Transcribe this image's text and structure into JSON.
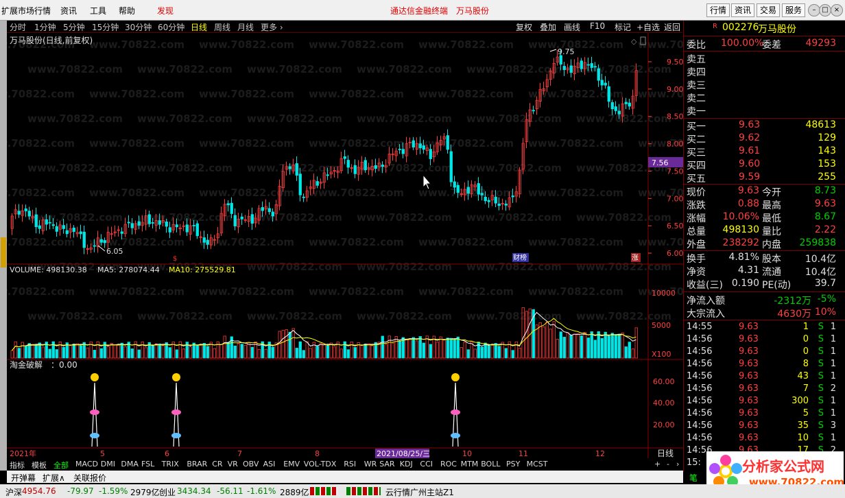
{
  "menu": {
    "items": [
      "扩展市场行情",
      "资讯",
      "工具",
      "帮助"
    ],
    "discover": "发现",
    "center_a": "通达信金融终端",
    "center_b": "万马股份",
    "right_tabs": [
      "行情",
      "资讯",
      "交易",
      "服务"
    ]
  },
  "periods": [
    "分时",
    "1分钟",
    "5分钟",
    "15分钟",
    "30分钟",
    "60分钟",
    "日线",
    "周线",
    "月线",
    "更多 ›"
  ],
  "active_period": "日线",
  "chart_tools": [
    "复权",
    "叠加",
    "画线",
    "F10",
    "标记",
    "+自选",
    "返回"
  ],
  "chart_title": "万马股份(日线,前复权)",
  "price_high_label": "9.75",
  "price_low_label": "6.05",
  "price_marker": "7.56",
  "price_axis": [
    "9.50",
    "9.00",
    "8.50",
    "8.00",
    "7.50",
    "7.00",
    "6.50",
    "6.00"
  ],
  "markers": {
    "finance": "财榜",
    "limit": "涨"
  },
  "volume_header": {
    "vol": "VOLUME: 498130.38",
    "ma5": "MA5: 278074.44",
    "ma10": "MA10: 275529.81"
  },
  "volume_axis": [
    "10000",
    "5000"
  ],
  "volume_unit": "X100",
  "indicator_header": "淘金破解　：0.00",
  "indicator_axis": [
    "60.00",
    "40.00",
    "20.00"
  ],
  "date_axis": [
    "2021年",
    "5",
    "6",
    "7",
    "8",
    "2021/08/25/三",
    "10",
    "11",
    "12"
  ],
  "timeframe_label": "日线",
  "indicator_tabs": [
    "指标",
    "模板",
    "全部",
    "MACD",
    "DMI",
    "DMA",
    "FSL",
    "TRIX",
    "BRAR",
    "CR",
    "VR",
    "OBV",
    "ASI",
    "EMV",
    "VOL-TDX",
    "RSI",
    "WR",
    "SAR",
    "KDJ",
    "CCI",
    "ROC",
    "MTM",
    "BOLL",
    "PSY",
    "MCST"
  ],
  "active_indicator_tab": "全部",
  "toolbar2": [
    "开弹幕",
    "扩展∧",
    "关联报价"
  ],
  "stock": {
    "flag": "R",
    "code": "002276",
    "name": "万马股份"
  },
  "webi": {
    "label": "委比",
    "value": "100.00%",
    "label2": "委差",
    "value2": "49293"
  },
  "sell": [
    {
      "l": "卖五",
      "p": "",
      "v": ""
    },
    {
      "l": "卖四",
      "p": "",
      "v": ""
    },
    {
      "l": "卖三",
      "p": "",
      "v": ""
    },
    {
      "l": "卖二",
      "p": "",
      "v": ""
    },
    {
      "l": "卖一",
      "p": "",
      "v": ""
    }
  ],
  "buy": [
    {
      "l": "买一",
      "p": "9.63",
      "v": "48613"
    },
    {
      "l": "买二",
      "p": "9.62",
      "v": "129"
    },
    {
      "l": "买三",
      "p": "9.61",
      "v": "143"
    },
    {
      "l": "买四",
      "p": "9.60",
      "v": "153"
    },
    {
      "l": "买五",
      "p": "9.59",
      "v": "255"
    }
  ],
  "quote": [
    {
      "a": "现价",
      "av": "9.63",
      "b": "今开",
      "bv": "8.73",
      "ac": "red",
      "bc": "grn"
    },
    {
      "a": "涨跌",
      "av": "0.88",
      "b": "最高",
      "bv": "9.63",
      "ac": "red",
      "bc": "red"
    },
    {
      "a": "涨幅",
      "av": "10.06%",
      "b": "最低",
      "bv": "8.67",
      "ac": "red",
      "bc": "grn"
    },
    {
      "a": "总量",
      "av": "498130",
      "b": "量比",
      "bv": "2.22",
      "ac": "yel",
      "bc": "red"
    },
    {
      "a": "外盘",
      "av": "238292",
      "b": "内盘",
      "bv": "259838",
      "ac": "red",
      "bc": "grn"
    }
  ],
  "fund": [
    {
      "a": "换手",
      "av": "4.81%",
      "b": "股本",
      "bv": "10.4亿"
    },
    {
      "a": "净资",
      "av": "4.31",
      "b": "流通",
      "bv": "10.4亿"
    },
    {
      "a": "收益(三)",
      "av": "0.190",
      "b": "PE(动)",
      "bv": "39.7"
    }
  ],
  "flow": [
    {
      "a": "净流入额",
      "av": "-2312万",
      "bv": "-5%",
      "c": "grn"
    },
    {
      "a": "大宗流入",
      "av": "4630万",
      "bv": "10%",
      "c": "red"
    }
  ],
  "ticks": [
    {
      "t": "14:55",
      "p": "9.63",
      "v": "1",
      "s": "S",
      "n": "1"
    },
    {
      "t": "14:56",
      "p": "9.63",
      "v": "0",
      "s": "S",
      "n": "1"
    },
    {
      "t": "14:56",
      "p": "9.63",
      "v": "0",
      "s": "S",
      "n": "1"
    },
    {
      "t": "14:56",
      "p": "9.63",
      "v": "8",
      "s": "S",
      "n": "1"
    },
    {
      "t": "14:56",
      "p": "9.63",
      "v": "43",
      "s": "S",
      "n": "1"
    },
    {
      "t": "14:56",
      "p": "9.63",
      "v": "7",
      "s": "S",
      "n": "2"
    },
    {
      "t": "14:56",
      "p": "9.63",
      "v": "300",
      "s": "S",
      "n": "1"
    },
    {
      "t": "14:56",
      "p": "9.63",
      "v": "5",
      "s": "S",
      "n": "1"
    },
    {
      "t": "14:56",
      "p": "9.63",
      "v": "35",
      "s": "S",
      "n": "3"
    },
    {
      "t": "14:56",
      "p": "9.63",
      "v": "10",
      "s": "S",
      "n": "1"
    },
    {
      "t": "14:56",
      "p": "9.63",
      "v": "17",
      "s": "S",
      "n": "2"
    },
    {
      "t": "15:",
      "p": "",
      "v": "",
      "s": "",
      "n": ""
    }
  ],
  "side_tab": "笔",
  "status": {
    "idx1_name": "沪深",
    "idx1": "4954.76",
    "idx1_chg": "-79.97",
    "idx1_pct": "-1.59%",
    "idx1_amt": "2979亿",
    "idx2_name": "创业",
    "idx2": "3434.34",
    "idx2_chg": "-56.11",
    "idx2_pct": "-1.61%",
    "idx2_amt": "2889亿",
    "server": "云行情广州主站Z1"
  },
  "watermark": "www.70822.com",
  "logo": {
    "title": "分析家公式网",
    "url": "www.70822.com"
  },
  "colors": {
    "up": "#ff3b3b",
    "down": "#00e6e6",
    "ma5": "#ffffff",
    "ma10": "#ffff00",
    "grid": "#8b0000"
  }
}
